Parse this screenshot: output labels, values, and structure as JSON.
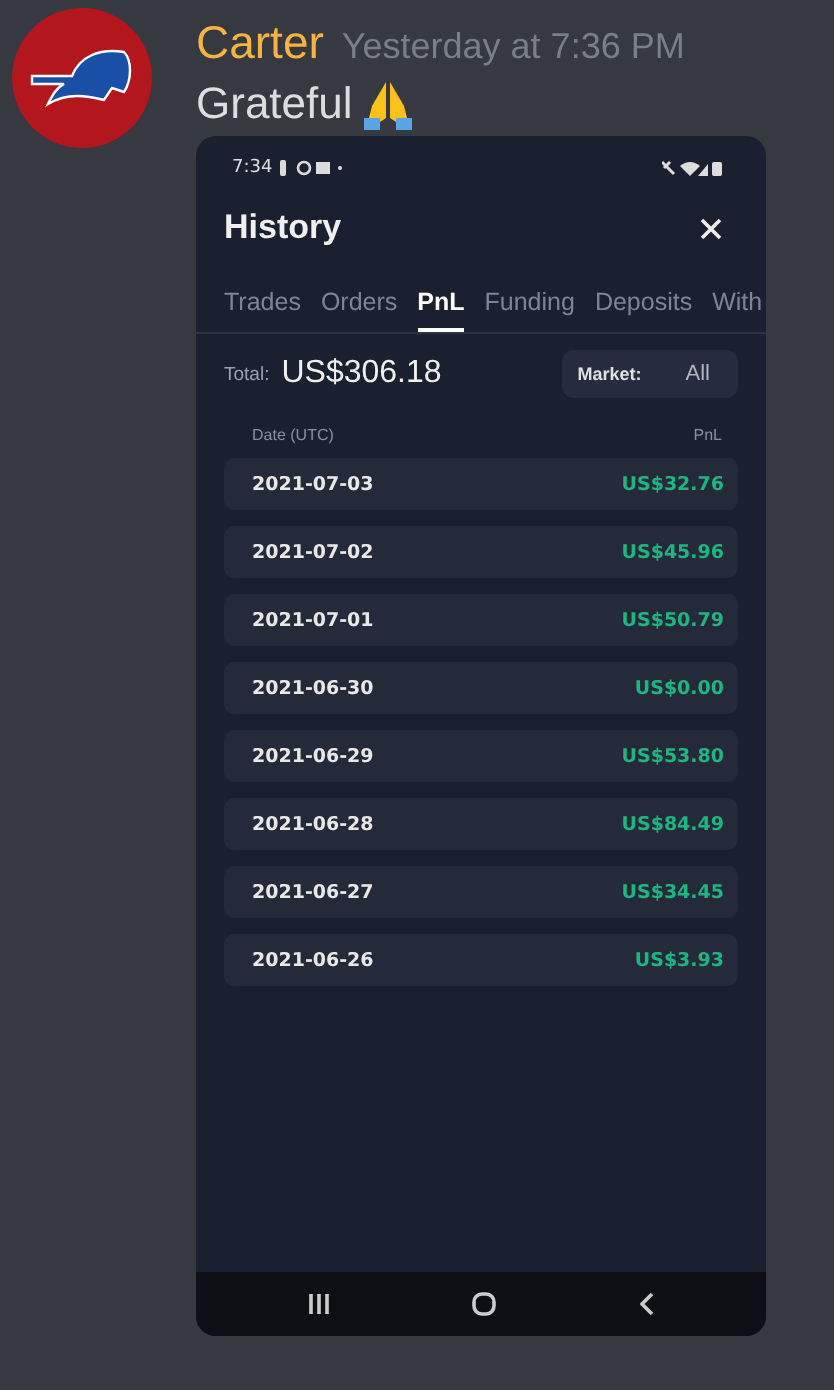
{
  "message": {
    "author": "Carter",
    "timestamp": "Yesterday at 7:36 PM",
    "text": "Grateful"
  },
  "phone": {
    "status_bar": {
      "time": "7:34"
    },
    "title": "History",
    "tabs": [
      {
        "label": "Trades",
        "selected": false
      },
      {
        "label": "Orders",
        "selected": false
      },
      {
        "label": "PnL",
        "selected": true
      },
      {
        "label": "Funding",
        "selected": false
      },
      {
        "label": "Deposits",
        "selected": false
      },
      {
        "label": "With",
        "selected": false
      }
    ],
    "total": {
      "label": "Total:",
      "value": "US$306.18"
    },
    "market_filter": {
      "label": "Market:",
      "value": "All"
    },
    "table": {
      "columns": [
        "Date (UTC)",
        "PnL"
      ],
      "rows": [
        {
          "date": "2021-07-03",
          "pnl": "US$32.76"
        },
        {
          "date": "2021-07-02",
          "pnl": "US$45.96"
        },
        {
          "date": "2021-07-01",
          "pnl": "US$50.79"
        },
        {
          "date": "2021-06-30",
          "pnl": "US$0.00"
        },
        {
          "date": "2021-06-29",
          "pnl": "US$53.80"
        },
        {
          "date": "2021-06-28",
          "pnl": "US$84.49"
        },
        {
          "date": "2021-06-27",
          "pnl": "US$34.45"
        },
        {
          "date": "2021-06-26",
          "pnl": "US$3.93"
        }
      ]
    }
  }
}
